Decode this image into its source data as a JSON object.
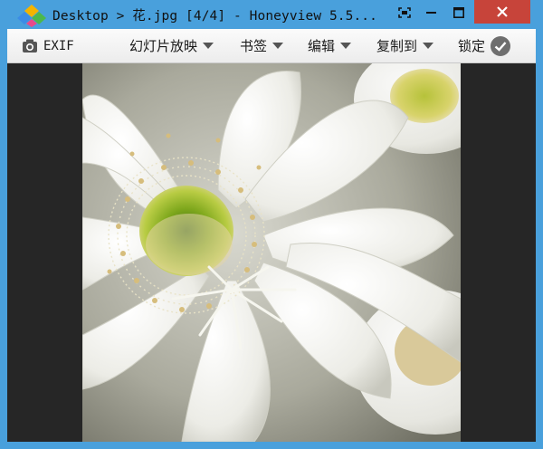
{
  "window": {
    "title": "Desktop > 花.jpg [4/4] - Honeyview 5.5...",
    "accent_color": "#49a0dc",
    "close_color": "#c7443a"
  },
  "titlebar_buttons": {
    "fullscreen_icon": "fullscreen-icon",
    "minimize_icon": "minimize-icon",
    "maximize_icon": "maximize-icon",
    "close_icon": "close-icon"
  },
  "toolbar": {
    "exif_label": "EXIF",
    "slideshow_label": "幻灯片放映",
    "bookmark_label": "书签",
    "edit_label": "编辑",
    "copyto_label": "复制到",
    "lock_label": "锁定"
  },
  "image": {
    "subject": "white cactus flower"
  }
}
